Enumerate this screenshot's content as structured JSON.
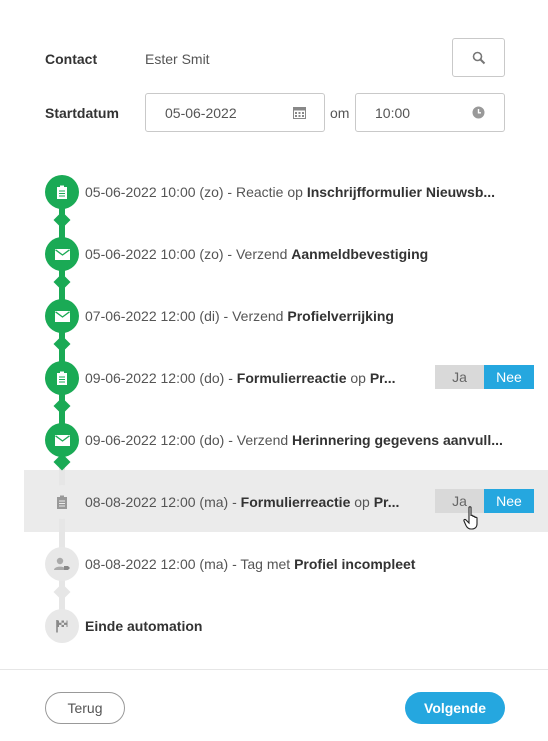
{
  "form": {
    "contact_label": "Contact",
    "contact_value": "Ester Smit",
    "startdatum_label": "Startdatum",
    "date_value": "05-06-2022",
    "om_label": "om",
    "time_value": "10:00"
  },
  "timeline": [
    {
      "prefix": "05-06-2022 10:00 (zo)  -  Reactie op ",
      "bold": "Inschrijfformulier Nieuwsb...",
      "suffix": ""
    },
    {
      "prefix": "05-06-2022 10:00 (zo)  -  Verzend ",
      "bold": "Aanmeldbevestiging",
      "suffix": ""
    },
    {
      "prefix": "07-06-2022 12:00 (di)  -  Verzend ",
      "bold": "Profielverrijking",
      "suffix": ""
    },
    {
      "prefix": "09-06-2022 12:00 (do)  -  ",
      "bold": "Formulierreactie",
      "suffix": " op ",
      "bold2": "Pr..."
    },
    {
      "prefix": "09-06-2022 12:00 (do)  -  Verzend ",
      "bold": "Herinnering gegevens aanvull...",
      "suffix": ""
    },
    {
      "prefix": "08-08-2022 12:00 (ma)  -  ",
      "bold": "Formulierreactie",
      "suffix": " op ",
      "bold2": "Pr..."
    },
    {
      "prefix": "08-08-2022 12:00 (ma)  -  Tag met ",
      "bold": "Profiel incompleet",
      "suffix": ""
    },
    {
      "prefix": "",
      "bold": "Einde automation",
      "suffix": ""
    }
  ],
  "choice": {
    "yes": "Ja",
    "no": "Nee"
  },
  "footer": {
    "back_label": "Terug",
    "next_label": "Volgende"
  },
  "colors": {
    "green": "#1aaa55",
    "blue": "#25a7df",
    "grey_node": "#e8e8e8"
  },
  "icons": [
    "search-icon",
    "calendar-icon",
    "clock-icon",
    "form-icon",
    "envelope-icon",
    "user-tag-icon",
    "flag-icon",
    "hand-cursor-icon"
  ]
}
